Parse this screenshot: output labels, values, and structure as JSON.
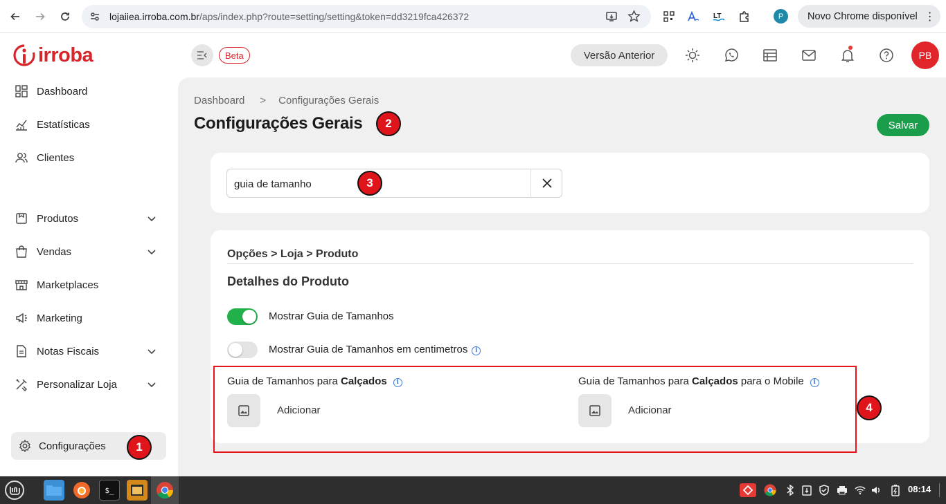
{
  "browser": {
    "url_host": "lojaiiea.irroba.com.br",
    "url_path": "/aps/index.php?route=setting/setting&token=dd3219fca426372",
    "profile_initial": "P",
    "update_label": "Novo Chrome disponível",
    "update_menu": "⋮"
  },
  "app": {
    "logo_text": "irroba",
    "beta_label": "Beta",
    "version_button": "Versão Anterior",
    "avatar_initials": "PB"
  },
  "sidebar": {
    "items": [
      {
        "label": "Dashboard",
        "icon": "dashboard-icon"
      },
      {
        "label": "Estatísticas",
        "icon": "stats-icon"
      },
      {
        "label": "Clientes",
        "icon": "users-icon"
      },
      {
        "label": "Produtos",
        "icon": "product-icon"
      },
      {
        "label": "Vendas",
        "icon": "bag-icon"
      },
      {
        "label": "Marketplaces",
        "icon": "store-icon"
      },
      {
        "label": "Marketing",
        "icon": "megaphone-icon"
      },
      {
        "label": "Notas Fiscais",
        "icon": "document-icon"
      },
      {
        "label": "Personalizar Loja",
        "icon": "tools-icon"
      }
    ],
    "config_label": "Configurações"
  },
  "breadcrumb": {
    "home": "Dashboard",
    "separator": ">",
    "current": "Configurações Gerais"
  },
  "page": {
    "title": "Configurações Gerais",
    "save_label": "Salvar"
  },
  "search": {
    "value": "guia de tamanho"
  },
  "section": {
    "path": "Opções > Loja > Produto",
    "title": "Detalhes do Produto",
    "toggles": [
      {
        "label": "Mostrar Guia de Tamanhos",
        "on": true
      },
      {
        "label": "Mostrar Guia de Tamanhos em centimetros",
        "on": false
      }
    ],
    "uploads": [
      {
        "prefix": "Guia de Tamanhos para ",
        "bold": "Calçados",
        "suffix": "",
        "button": "Adicionar"
      },
      {
        "prefix": "Guia de Tamanhos para ",
        "bold": "Calçados",
        "suffix": " para o Mobile",
        "button": "Adicionar"
      }
    ]
  },
  "markers": [
    "1",
    "2",
    "3",
    "4"
  ],
  "taskbar": {
    "clock": "08:14"
  },
  "colors": {
    "brand_red": "#d7262b",
    "save_green": "#1b9e4b",
    "toggle_on": "#22b04b",
    "toggle_off": "#e4e4e4",
    "marker_red": "#e0151c",
    "info_blue": "#3d7bd9"
  }
}
